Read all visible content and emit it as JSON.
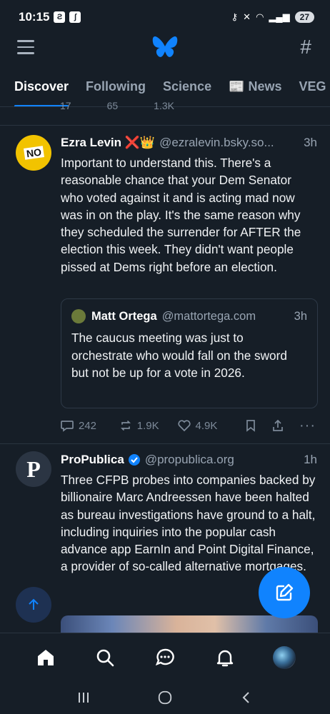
{
  "status_bar": {
    "time": "10:15",
    "battery": "27"
  },
  "tabs": [
    {
      "label": "Discover",
      "active": true
    },
    {
      "label": "Following"
    },
    {
      "label": "Science"
    },
    {
      "label": "📰 News"
    },
    {
      "label": "VEG"
    }
  ],
  "prev_post_actions": {
    "replies": "17",
    "reposts": "65",
    "likes": "1.3K"
  },
  "post1": {
    "avatar_text": "NO",
    "author": "Ezra Levin ❌👑",
    "handle": "@ezralevin.bsky.so...",
    "time": "3h",
    "text": "Important to understand this. There's a reasonable chance that your Dem Senator who voted against it and is acting mad now was in on the play. It's the same reason why they scheduled the surrender for AFTER the election this week. They didn't want people pissed at Dems right before an election.",
    "quote": {
      "author": "Matt Ortega",
      "handle": "@mattortega.com",
      "time": "3h",
      "text": "The caucus meeting was just to orchestrate who would fall on the sword but not be up for a vote in 2026."
    },
    "actions": {
      "replies": "242",
      "reposts": "1.9K",
      "likes": "4.9K"
    }
  },
  "post2": {
    "avatar_text": "P",
    "author": "ProPublica",
    "handle": "@propublica.org",
    "time": "1h",
    "text": "Three CFPB probes into companies backed by billionaire Marc Andreessen have been halted as bureau investigations have ground to a halt, including inquiries into the popular cash advance app EarnIn and Point Digital Finance, a provider of so-called alternative mortgages."
  },
  "colors": {
    "accent": "#1083fe",
    "background": "#161e27",
    "muted": "#98a4b2"
  }
}
